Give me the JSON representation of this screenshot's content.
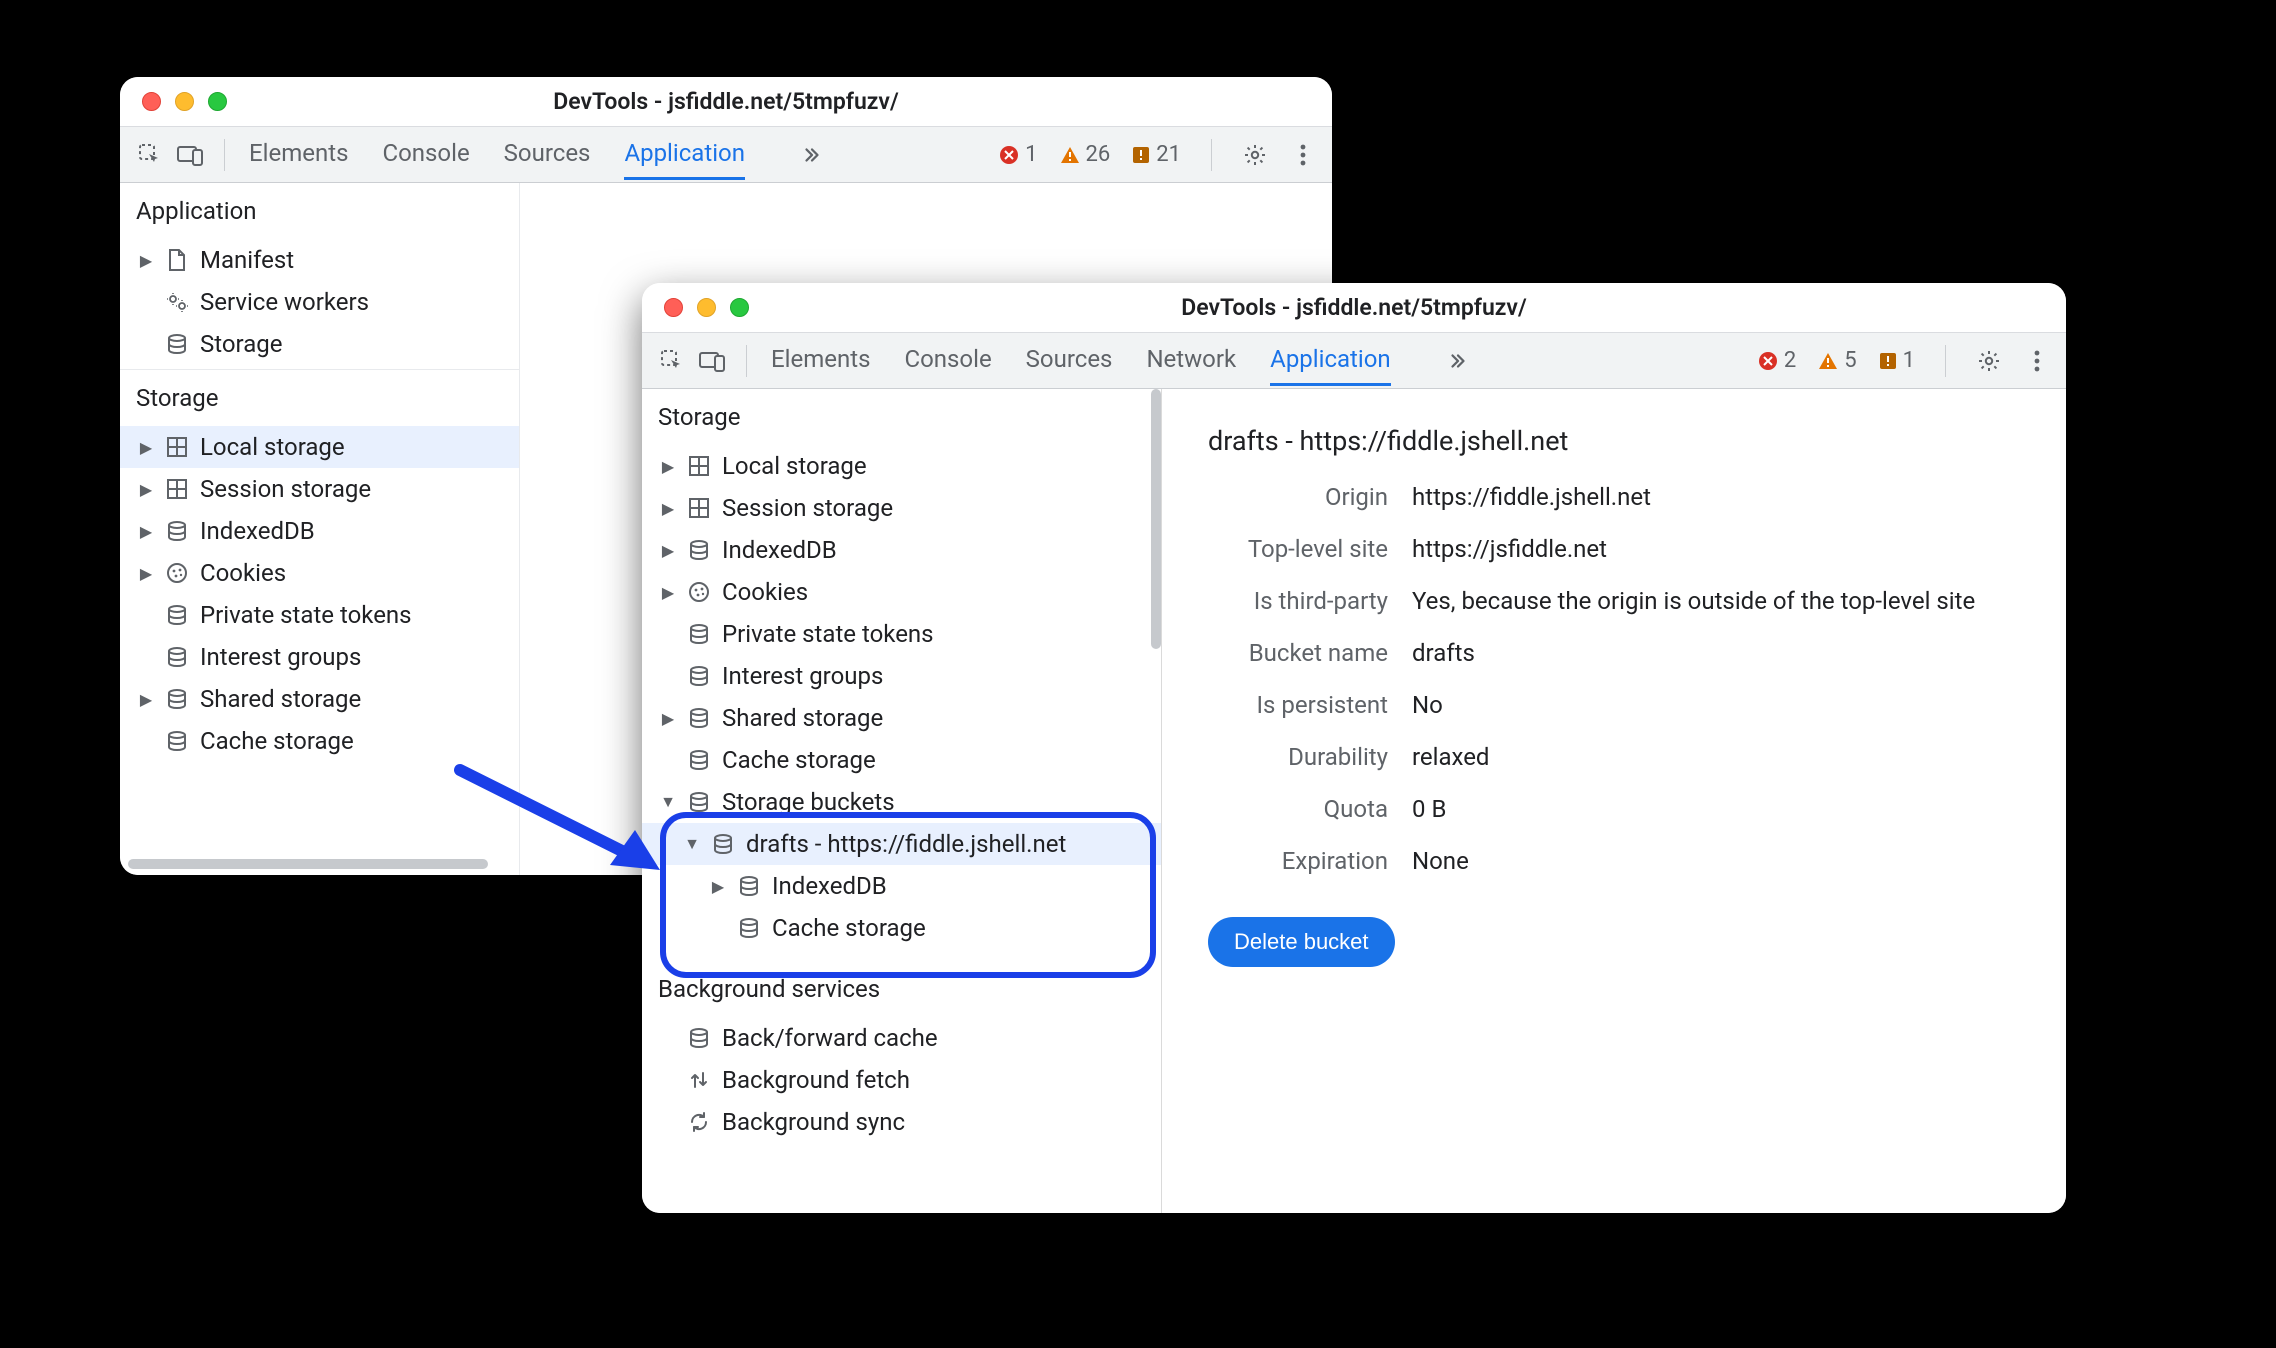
{
  "colors": {
    "accent": "#1a73e8",
    "highlight": "#1a3fe8"
  },
  "window1": {
    "title": "DevTools - jsfiddle.net/5tmpfuzv/",
    "tabs": [
      "Elements",
      "Console",
      "Sources",
      "Application"
    ],
    "active_tab_index": 3,
    "counts": {
      "errors": "1",
      "warnings": "26",
      "info": "21"
    },
    "sections": {
      "application": {
        "header": "Application",
        "items": [
          {
            "icon": "file-icon",
            "label": "Manifest",
            "expandable": true
          },
          {
            "icon": "gears-icon",
            "label": "Service workers",
            "expandable": false
          },
          {
            "icon": "db-icon",
            "label": "Storage",
            "expandable": false
          }
        ]
      },
      "storage": {
        "header": "Storage",
        "items": [
          {
            "icon": "grid-icon",
            "label": "Local storage",
            "expandable": true,
            "selected": true
          },
          {
            "icon": "grid-icon",
            "label": "Session storage",
            "expandable": true
          },
          {
            "icon": "db-icon",
            "label": "IndexedDB",
            "expandable": true
          },
          {
            "icon": "cookie-icon",
            "label": "Cookies",
            "expandable": true
          },
          {
            "icon": "db-icon",
            "label": "Private state tokens",
            "expandable": false
          },
          {
            "icon": "db-icon",
            "label": "Interest groups",
            "expandable": false
          },
          {
            "icon": "db-icon",
            "label": "Shared storage",
            "expandable": true
          },
          {
            "icon": "db-icon",
            "label": "Cache storage",
            "expandable": false
          }
        ]
      }
    }
  },
  "window2": {
    "title": "DevTools - jsfiddle.net/5tmpfuzv/",
    "tabs": [
      "Elements",
      "Console",
      "Sources",
      "Network",
      "Application"
    ],
    "active_tab_index": 4,
    "counts": {
      "errors": "2",
      "warnings": "5",
      "info": "1"
    },
    "sidebar": {
      "storage_header": "Storage",
      "storage_items": [
        {
          "indent": 0,
          "arrow": "▶",
          "icon": "grid-icon",
          "label": "Local storage"
        },
        {
          "indent": 0,
          "arrow": "▶",
          "icon": "grid-icon",
          "label": "Session storage"
        },
        {
          "indent": 0,
          "arrow": "▶",
          "icon": "db-icon",
          "label": "IndexedDB"
        },
        {
          "indent": 0,
          "arrow": "▶",
          "icon": "cookie-icon",
          "label": "Cookies"
        },
        {
          "indent": 0,
          "arrow": "",
          "icon": "db-icon",
          "label": "Private state tokens"
        },
        {
          "indent": 0,
          "arrow": "",
          "icon": "db-icon",
          "label": "Interest groups"
        },
        {
          "indent": 0,
          "arrow": "▶",
          "icon": "db-icon",
          "label": "Shared storage"
        },
        {
          "indent": 0,
          "arrow": "",
          "icon": "db-icon",
          "label": "Cache storage"
        },
        {
          "indent": 0,
          "arrow": "▼",
          "icon": "db-icon",
          "label": "Storage buckets"
        },
        {
          "indent": 1,
          "arrow": "▼",
          "icon": "db-icon",
          "label": "drafts - https://fiddle.jshell.net",
          "selected": true
        },
        {
          "indent": 2,
          "arrow": "▶",
          "icon": "db-icon",
          "label": "IndexedDB"
        },
        {
          "indent": 2,
          "arrow": "",
          "icon": "db-icon",
          "label": "Cache storage"
        }
      ],
      "bg_header": "Background services",
      "bg_items": [
        {
          "icon": "db-icon",
          "label": "Back/forward cache"
        },
        {
          "icon": "updown-icon",
          "label": "Background fetch"
        },
        {
          "icon": "sync-icon",
          "label": "Background sync"
        }
      ]
    },
    "detail": {
      "heading": "drafts - https://fiddle.jshell.net",
      "props": [
        {
          "k": "Origin",
          "v": "https://fiddle.jshell.net"
        },
        {
          "k": "Top-level site",
          "v": "https://jsfiddle.net"
        },
        {
          "k": "Is third-party",
          "v": "Yes, because the origin is outside of the top-level site"
        },
        {
          "k": "Bucket name",
          "v": "drafts"
        },
        {
          "k": "Is persistent",
          "v": "No"
        },
        {
          "k": "Durability",
          "v": "relaxed"
        },
        {
          "k": "Quota",
          "v": "0 B"
        },
        {
          "k": "Expiration",
          "v": "None"
        }
      ],
      "delete_label": "Delete bucket"
    }
  }
}
